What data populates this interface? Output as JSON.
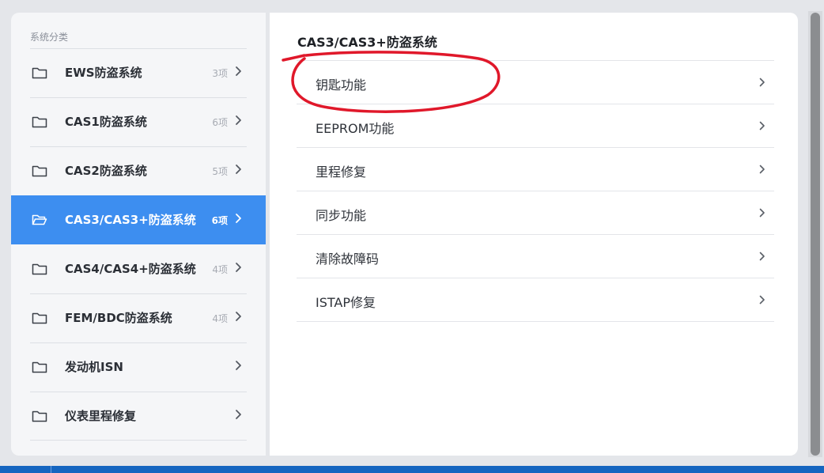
{
  "left_panel": {
    "title": "系统分类",
    "categories": [
      {
        "label": "EWS防盗系统",
        "count": "3项"
      },
      {
        "label": "CAS1防盗系统",
        "count": "6项"
      },
      {
        "label": "CAS2防盗系统",
        "count": "5项"
      },
      {
        "label": "CAS3/CAS3+防盗系统",
        "count": "6项",
        "selected": true
      },
      {
        "label": "CAS4/CAS4+防盗系统",
        "count": "4项"
      },
      {
        "label": "FEM/BDC防盗系统",
        "count": "4项"
      },
      {
        "label": "发动机ISN",
        "count": ""
      },
      {
        "label": "仪表里程修复",
        "count": ""
      }
    ]
  },
  "right_panel": {
    "title": "CAS3/CAS3+防盗系统",
    "functions": [
      {
        "label": "钥匙功能"
      },
      {
        "label": "EEPROM功能"
      },
      {
        "label": "里程修复"
      },
      {
        "label": "同步功能"
      },
      {
        "label": "清除故障码"
      },
      {
        "label": "ISTAP修复"
      }
    ]
  },
  "icons": {
    "folder": "folder-icon",
    "folder_open": "folder-open-icon",
    "chevron": "chevron-right-icon"
  },
  "colors": {
    "accent": "#3d8ef0",
    "annotation": "#e0182a",
    "taskbar": "#1565c0"
  }
}
